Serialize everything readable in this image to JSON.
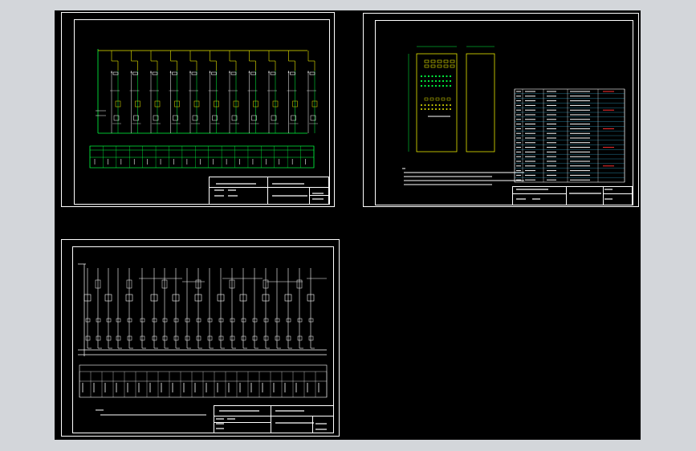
{
  "colors": {
    "background_outer": "#d3d6da",
    "canvas": "#000000",
    "frame": "#ffffff",
    "wire_yellow": "#e8e800",
    "wire_green": "#00ff40",
    "wire_white": "#ffffff",
    "accent_cyan": "#3fd0ff",
    "accent_red": "#ff3030"
  },
  "sheets": [
    {
      "name": "sheet-1",
      "content": "schematic-vertical-branches"
    },
    {
      "name": "sheet-2",
      "content": "cabinet-layout-and-parts-list"
    },
    {
      "name": "sheet-3",
      "content": "schematic-feeder-circuits"
    }
  ]
}
